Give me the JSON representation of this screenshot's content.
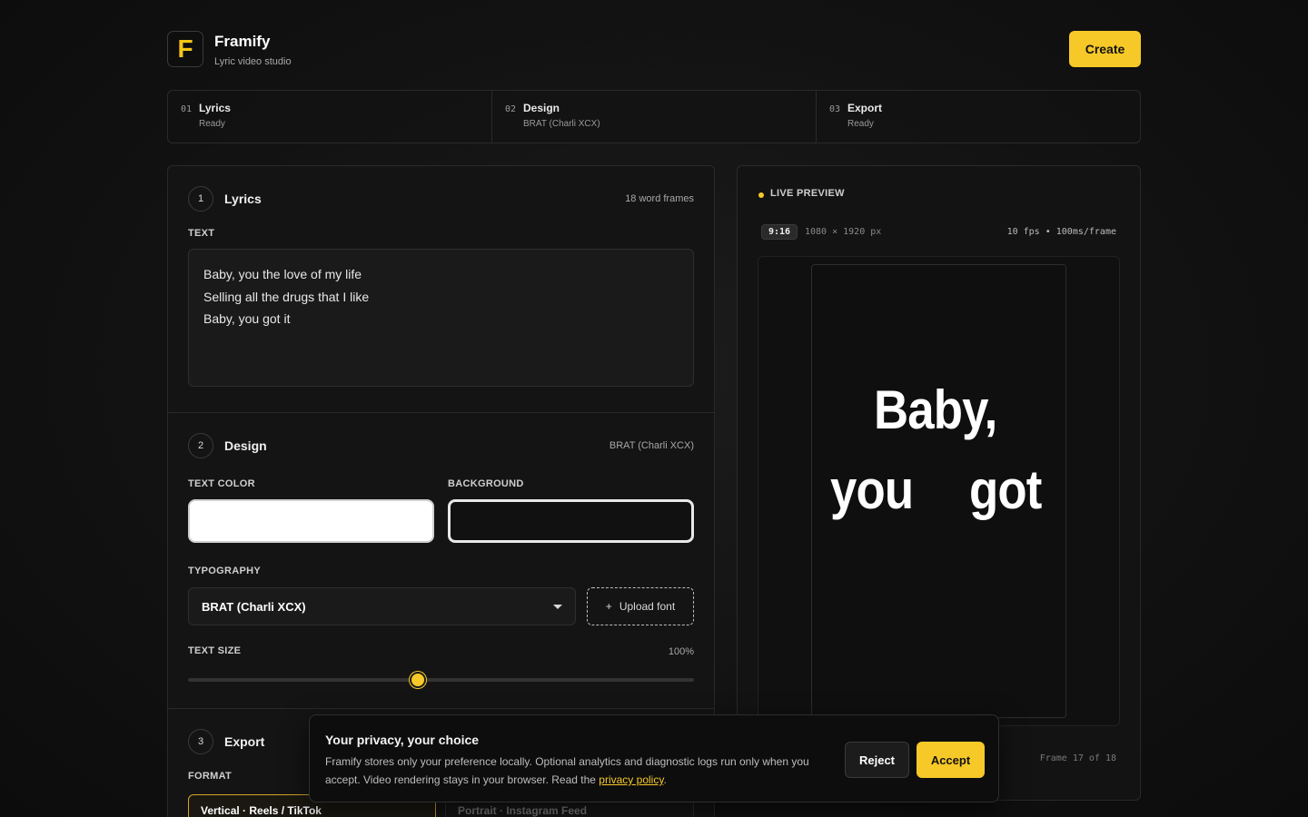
{
  "brand": {
    "logo_letter": "F",
    "name": "Framify",
    "tagline": "Lyric video studio"
  },
  "header": {
    "create_label": "Create"
  },
  "steps": [
    {
      "num": "01",
      "title": "Lyrics",
      "status": "Ready"
    },
    {
      "num": "02",
      "title": "Design",
      "status": "BRAT (Charli XCX)"
    },
    {
      "num": "03",
      "title": "Export",
      "status": "Ready"
    }
  ],
  "lyrics_section": {
    "num": "1",
    "title": "Lyrics",
    "meta": "18 word frames",
    "text_label": "TEXT",
    "lines": [
      "Baby, you the love of my life",
      "Selling all the drugs that I like",
      "Baby, you got it"
    ]
  },
  "design_section": {
    "num": "2",
    "title": "Design",
    "meta": "BRAT (Charli XCX)",
    "text_color_label": "TEXT COLOR",
    "background_label": "BACKGROUND",
    "text_color": "#ffffff",
    "background_color": "#111111",
    "typography_label": "TYPOGRAPHY",
    "font_selected": "BRAT (Charli XCX)",
    "upload_icon": "+",
    "upload_label": "Upload font",
    "text_size_label": "TEXT SIZE",
    "text_size_value": "100%",
    "slider_fraction": 0.455
  },
  "export_section": {
    "num": "3",
    "title": "Export",
    "format_label": "FORMAT",
    "formats": [
      "Vertical · Reels / TikTok",
      "Portrait · Instagram Feed"
    ]
  },
  "preview": {
    "live_label": "LIVE PREVIEW",
    "ratio": "9:16",
    "dims": "1080 × 1920 px",
    "fps": "10 fps • 100ms/frame",
    "words": [
      "Baby,",
      "you",
      "got"
    ],
    "frame_counter": "Frame 17 of 18"
  },
  "cookie": {
    "title": "Your privacy, your choice",
    "body": "Framify stores only your preference locally. Optional analytics and diagnostic logs run only when you accept. Video rendering stays in your browser. Read the",
    "link": "privacy policy",
    "body_end": ".",
    "reject_label": "Reject",
    "accept_label": "Accept"
  },
  "colors": {
    "accent": "#f7c928"
  }
}
